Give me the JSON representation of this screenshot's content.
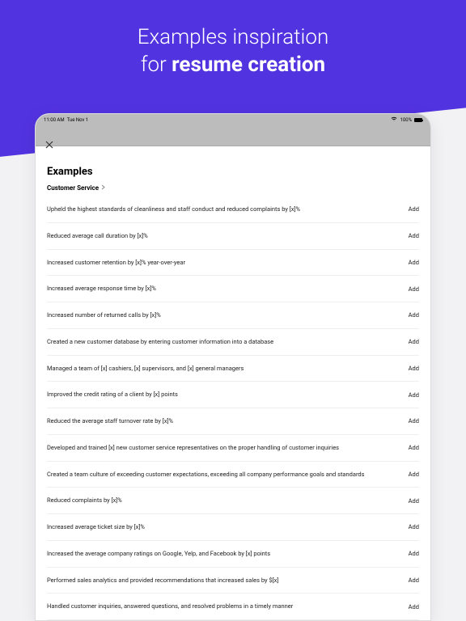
{
  "hero": {
    "line1": "Examples inspiration",
    "line2_prefix": "for ",
    "line2_bold": "resume creation"
  },
  "status": {
    "time": "11:00 AM",
    "date": "Tue Nov 1",
    "battery": "100%"
  },
  "modal": {
    "title": "Examples",
    "category": "Customer Service",
    "add_label": "Add",
    "examples": [
      "Upheld the highest standards of cleanliness and staff conduct and reduced complaints by [x]%",
      "Reduced average call duration by [x]%",
      "Increased customer retention by [x]% year-over-year",
      "Increased average response time by [x]%",
      "Increased number of returned calls by [x]%",
      "Created a new customer database by entering customer information into a database",
      "Managed a team of [x] cashiers, [x] supervisors, and [x] general managers",
      "Improved the credit rating of a client by [x] points",
      "Reduced the average staff turnover rate by [x]%",
      "Developed and trained [x] new customer service representatives on the proper handling of customer inquiries",
      "Created a team culture of exceeding customer expectations, exceeding all company performance goals and standards",
      "Reduced complaints by [x]%",
      "Increased average ticket size by [x]%",
      "Increased the average company ratings on Google, Yelp, and Facebook by [x] points",
      "Performed sales analytics and provided recommendations that increased sales by $[x]",
      "Handled customer inquiries, answered questions, and resolved problems in a timely manner"
    ]
  }
}
